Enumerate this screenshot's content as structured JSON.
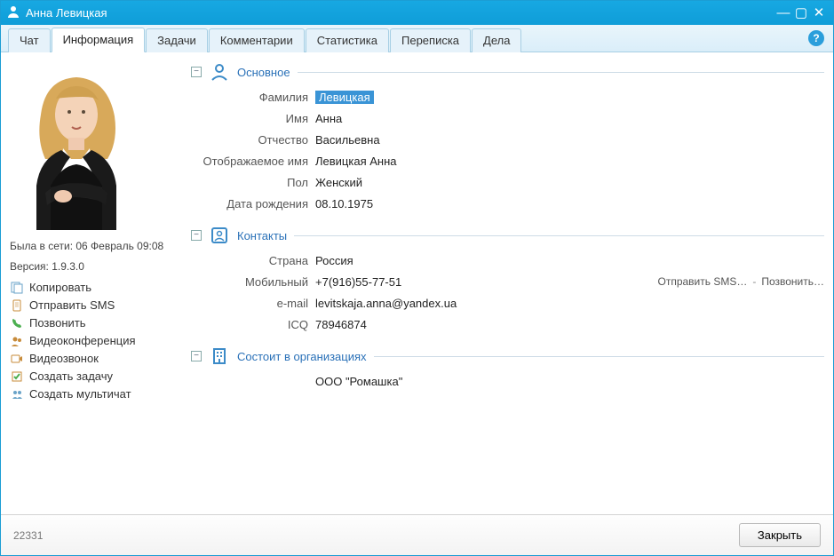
{
  "window": {
    "title": "Анна Левицкая"
  },
  "tabs": {
    "chat": "Чат",
    "info": "Информация",
    "tasks": "Задачи",
    "comments": "Комментарии",
    "statistics": "Статистика",
    "correspondence": "Переписка",
    "cases": "Дела"
  },
  "side": {
    "last_seen": "Была в сети: 06 Февраль 09:08",
    "version": "Версия: 1.9.3.0",
    "actions": {
      "copy": "Копировать",
      "send_sms": "Отправить SMS",
      "call": "Позвонить",
      "video_conf": "Видеоконференция",
      "video_call": "Видеозвонок",
      "create_task": "Создать задачу",
      "create_multichat": "Создать мультичат"
    }
  },
  "sections": {
    "basic": {
      "title": "Основное",
      "labels": {
        "surname": "Фамилия",
        "name": "Имя",
        "patronymic": "Отчество",
        "display_name": "Отображаемое имя",
        "gender": "Пол",
        "birthdate": "Дата рождения"
      },
      "values": {
        "surname": "Левицкая",
        "name": "Анна",
        "patronymic": "Васильевна",
        "display_name": "Левицкая Анна",
        "gender": "Женский",
        "birthdate": "08.10.1975"
      }
    },
    "contacts": {
      "title": "Контакты",
      "labels": {
        "country": "Страна",
        "mobile": "Мобильный",
        "email": "e-mail",
        "icq": "ICQ"
      },
      "values": {
        "country": "Россия",
        "mobile": "+7(916)55-77-51",
        "email": "levitskaja.anna@yandex.ua",
        "icq": "78946874"
      },
      "actions": {
        "send_sms": "Отправить SMS…",
        "dash": "-",
        "call": "Позвонить…"
      }
    },
    "orgs": {
      "title": "Состоит в организациях",
      "value": "ООО \"Ромашка\""
    }
  },
  "footer": {
    "status": "22331",
    "close": "Закрыть"
  }
}
